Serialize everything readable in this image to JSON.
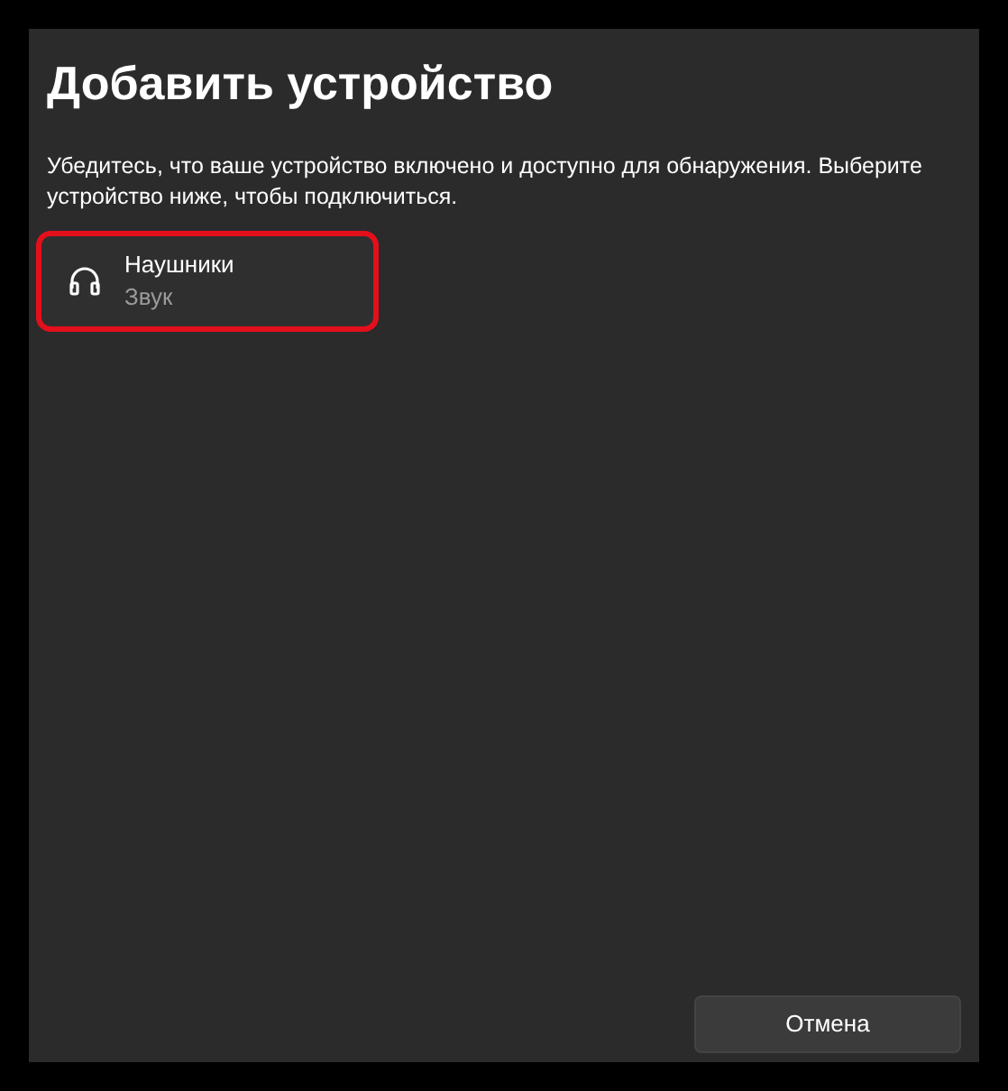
{
  "dialog": {
    "title": "Добавить устройство",
    "description": "Убедитесь, что ваше устройство включено и доступно для обнаружения. Выберите устройство ниже, чтобы подключиться."
  },
  "devices": [
    {
      "name": "Наушники",
      "type": "Звук",
      "kind": "headphones",
      "highlighted": true
    }
  ],
  "buttons": [
    {
      "label": "Отмена"
    }
  ]
}
